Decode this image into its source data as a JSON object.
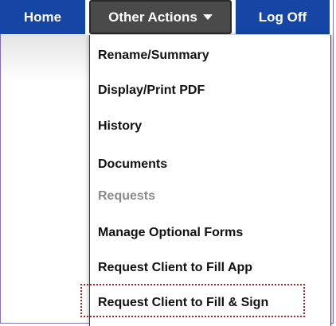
{
  "nav": {
    "home_label": "Home",
    "other_actions_label": "Other Actions",
    "logoff_label": "Log Off"
  },
  "menu": {
    "items": [
      {
        "label": "Rename/Summary",
        "enabled": true
      },
      {
        "label": "Display/Print PDF",
        "enabled": true
      },
      {
        "label": "History",
        "enabled": true
      },
      {
        "label": "Documents",
        "enabled": true
      },
      {
        "label": "Requests",
        "enabled": false
      },
      {
        "label": "Manage Optional Forms",
        "enabled": true
      },
      {
        "label": "Request Client to Fill App",
        "enabled": true
      },
      {
        "label": "Request Client to Fill & Sign",
        "enabled": true
      }
    ]
  },
  "icons": {
    "dropdown": "caret-down-icon"
  },
  "colors": {
    "nav_blue": "#1546a6",
    "nav_active": "#4a4a4a",
    "highlight": "#b22222",
    "frame": "#8a73b8"
  }
}
